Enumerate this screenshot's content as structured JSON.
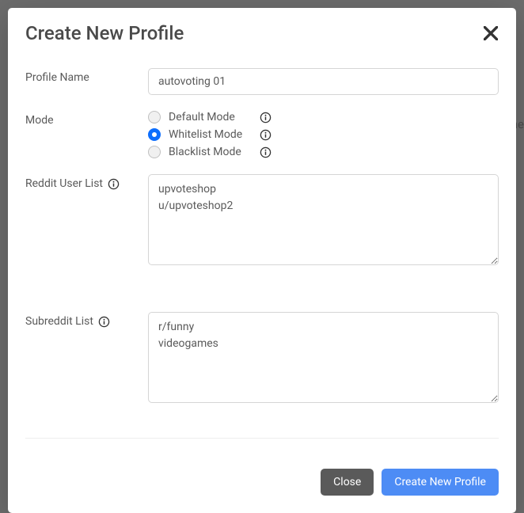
{
  "bg_text": "ne",
  "modal": {
    "title": "Create New Profile",
    "fields": {
      "profile_name": {
        "label": "Profile Name",
        "value": "autovoting 01"
      },
      "mode": {
        "label": "Mode",
        "options": [
          {
            "label": "Default Mode",
            "checked": false
          },
          {
            "label": "Whitelist Mode",
            "checked": true
          },
          {
            "label": "Blacklist Mode",
            "checked": false
          }
        ]
      },
      "reddit_user_list": {
        "label": "Reddit User List",
        "value": "upvoteshop\nu/upvoteshop2"
      },
      "subreddit_list": {
        "label": "Subreddit List",
        "value": "r/funny\nvideogames"
      }
    },
    "buttons": {
      "close": "Close",
      "submit": "Create New Profile"
    }
  }
}
